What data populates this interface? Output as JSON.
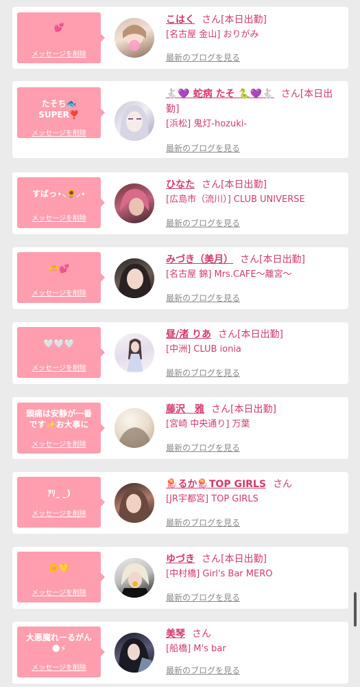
{
  "delete_label": "メッセージを削除",
  "blog_label": "最新のブログを見る",
  "colors": {
    "accent": "#d23a6e",
    "bubble": "#ff9eae",
    "link_gray": "#8a8a8a"
  },
  "entries": [
    {
      "message": "💕",
      "name": "こはく",
      "suffix": "さん[本日出勤]",
      "shop": "[名古屋 金山] おりがみ"
    },
    {
      "message": "たそち🐟\nSUPER❣️",
      "name": "🐇💜 蛇病 たそ 🐍💜🐇",
      "suffix": "さん[本日出勤]",
      "shop": "[浜松] 鬼灯-hozuki-"
    },
    {
      "message": "すばっ⋆⸜🌻⸝⋆",
      "name": "ひなた",
      "suffix": "さん[本日出勤]",
      "shop": "[広島市（流川）] CLUB UNIVERSE"
    },
    {
      "message": "🫶💕",
      "name": "みづき（美月）",
      "suffix": "さん[本日出勤]",
      "shop": "[名古屋 錦] Mrs.CAFE〜離宮〜"
    },
    {
      "message": "🤍🤍🤍",
      "name": "昼/渚 りあ",
      "suffix": "さん[本日出勤]",
      "shop": "[中洲] CLUB ionia"
    },
    {
      "message": "頭痛は安静が一番\nです✨お大事に",
      "name": "藤沢　雅",
      "suffix": "さん[本日出勤]",
      "shop": "[宮崎 中央通り] 万葉"
    },
    {
      "message": "ｱﾘ_ _)",
      "name": "🪼るか🪼TOP GIRLS",
      "suffix": "さん",
      "shop": "[JR宇都宮] TOP GIRLS"
    },
    {
      "message": "🌼💛",
      "name": "ゆづき",
      "suffix": "さん[本日出勤]",
      "shop": "[中村橋] Girl's Bar MERO"
    },
    {
      "message": "大悪魔れーるがん\n🌑⚡",
      "name": "美琴",
      "suffix": "さん",
      "shop": "[船橋] M's bar"
    }
  ]
}
